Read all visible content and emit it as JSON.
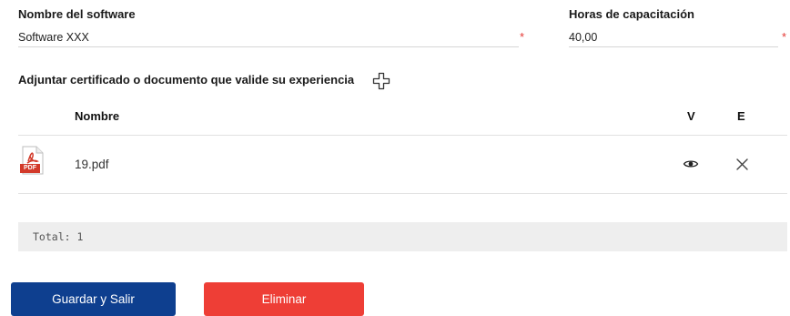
{
  "form": {
    "software_label": "Nombre del software",
    "software_value": "Software XXX",
    "hours_label": "Horas de capacitación",
    "hours_value": "40,00",
    "required_mark": "*"
  },
  "attachments": {
    "label": "Adjuntar certificado o documento que valide su experiencia",
    "add_icon": "plus-outline-icon",
    "columns": {
      "name": "Nombre",
      "view": "V",
      "edit": "E"
    },
    "rows": [
      {
        "file_icon": "pdf-file-icon",
        "file_badge": "PDF",
        "name": "19.pdf",
        "view_icon": "eye-icon",
        "delete_icon": "close-icon"
      }
    ],
    "total": "Total: 1"
  },
  "actions": {
    "save_label": "Guardar y Salir",
    "delete_label": "Eliminar"
  },
  "colors": {
    "primary": "#0e3f8f",
    "danger": "#ee3e36",
    "required": "#e53935",
    "pdf": "#d23a2a"
  }
}
